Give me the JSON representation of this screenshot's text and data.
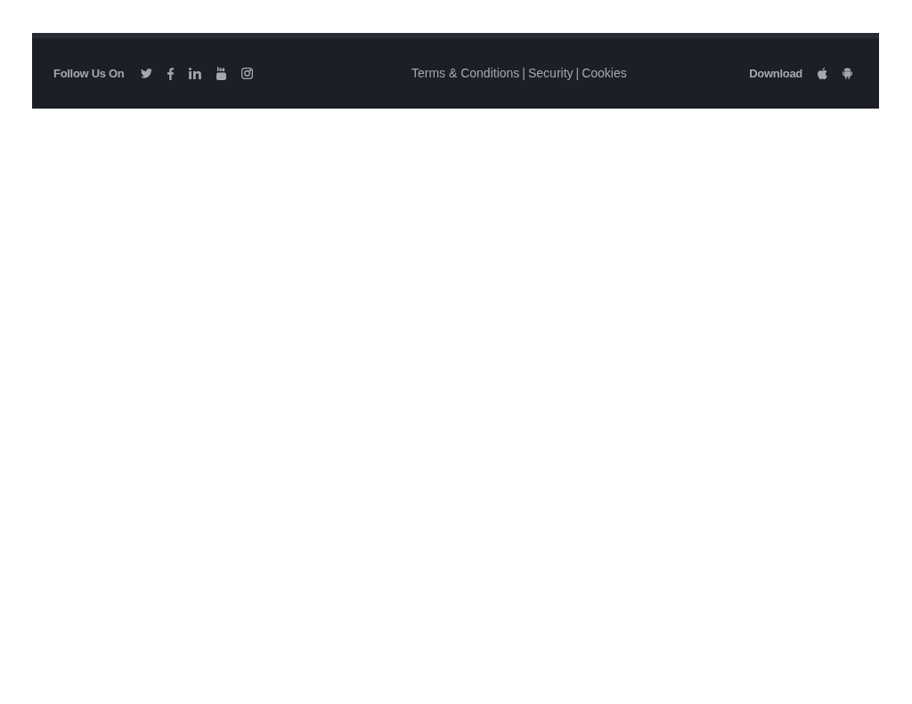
{
  "footer": {
    "follow_label": "Follow Us On",
    "social_icons": [
      {
        "kind": "twitter"
      },
      {
        "kind": "facebook"
      },
      {
        "kind": "linkedin"
      },
      {
        "kind": "youtube"
      },
      {
        "kind": "instagram"
      }
    ],
    "links": [
      "Terms & Conditions",
      "Security",
      "Cookies"
    ],
    "separator": "|",
    "download_label": "Download",
    "download_icons": [
      {
        "kind": "apple"
      },
      {
        "kind": "android"
      }
    ]
  }
}
